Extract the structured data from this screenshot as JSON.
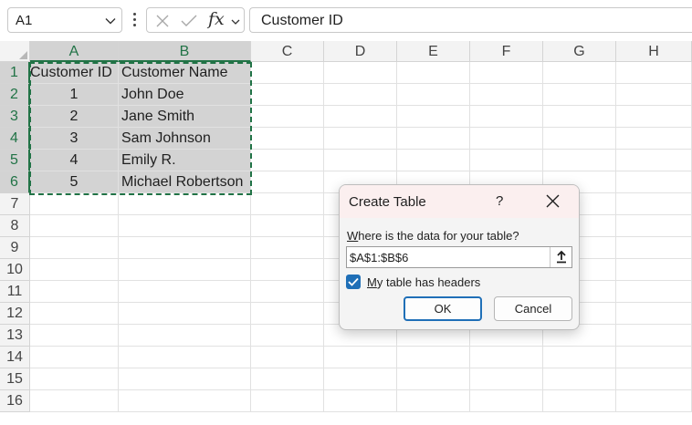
{
  "formula_bar": {
    "name_box": "A1",
    "fx_label": "fx",
    "formula": "Customer ID"
  },
  "columns": [
    "A",
    "B",
    "C",
    "D",
    "E",
    "F",
    "G",
    "H"
  ],
  "rows": [
    "1",
    "2",
    "3",
    "4",
    "5",
    "6",
    "7",
    "8",
    "9",
    "10",
    "11",
    "12",
    "13",
    "14",
    "15",
    "16"
  ],
  "cells": {
    "header": [
      "Customer ID",
      "Customer Name"
    ],
    "data": [
      [
        "1",
        "John Doe"
      ],
      [
        "2",
        "Jane Smith"
      ],
      [
        "3",
        "Sam Johnson"
      ],
      [
        "4",
        "Emily R."
      ],
      [
        "5",
        "Michael Robertson"
      ]
    ]
  },
  "dialog": {
    "title": "Create Table",
    "help": "?",
    "prompt_underlined": "W",
    "prompt_rest": "here is the data for your table?",
    "range": "$A$1:$B$6",
    "checkbox_checked": true,
    "checkbox_underlined": "M",
    "checkbox_rest": "y table has headers",
    "ok_label": "OK",
    "cancel_label": "Cancel"
  },
  "colors": {
    "selection_accent": "#217346",
    "selection_fill": "#d3d3d3",
    "checkbox": "#1f6fb7"
  }
}
